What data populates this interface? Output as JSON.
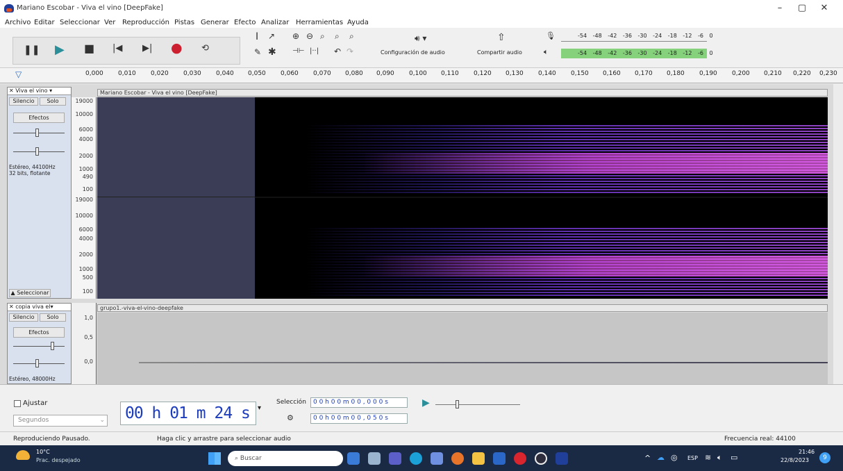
{
  "window": {
    "title": "Mariano Escobar - Viva el vino [DeepFake]",
    "min": "–",
    "max": "▢",
    "close": "✕"
  },
  "menu": [
    "Archivo",
    "Editar",
    "Seleccionar",
    "Ver",
    "Reproducción",
    "Pistas",
    "Generar",
    "Efecto",
    "Analizar",
    "Herramientas",
    "Ayuda"
  ],
  "toolbar": {
    "audio_setup": "Configuración de audio",
    "share_audio": "Compartir audio",
    "meter_ticks": [
      "-54",
      "-48",
      "-42",
      "-36",
      "-30",
      "-24",
      "-18",
      "-12",
      "-6",
      "0"
    ]
  },
  "ruler": [
    "0,000",
    "0,010",
    "0,020",
    "0,030",
    "0,040",
    "0,050",
    "0,060",
    "0,070",
    "0,080",
    "0,090",
    "0,100",
    "0,110",
    "0,120",
    "0,130",
    "0,140",
    "0,150",
    "0,160",
    "0,170",
    "0,180",
    "0,190",
    "0,200",
    "0,210",
    "0,220",
    "0,230"
  ],
  "track1": {
    "name": "Viva el vino",
    "mute": "Silencio",
    "solo": "Solo",
    "effects": "Efectos",
    "info": "Estéreo, 44100Hz\n32 bits, flotante",
    "select": "Seleccionar",
    "clip": "Mariano Escobar - Viva el vino [DeepFake]",
    "scale_top": [
      "19000",
      "10000",
      "6000",
      "4000",
      "2000",
      "1000",
      "490",
      "100"
    ],
    "scale_bottom": [
      "19000",
      "10000",
      "6000",
      "4000",
      "2000",
      "1000",
      "500",
      "100"
    ]
  },
  "track2": {
    "name": "copia viva el",
    "mute": "Silencio",
    "solo": "Solo",
    "effects": "Efectos",
    "info": "Estéreo, 48000Hz",
    "clip": "grupo1.-viva-el-vino-deepfake",
    "scale": [
      "1,0",
      "0,5",
      "0,0"
    ]
  },
  "bottom": {
    "snap": "Ajustar",
    "unit": "Segundos",
    "time": "00 h 01 m 24 s",
    "selection_label": "Selección",
    "sel_start": "0 0 h 0 0 m 0 0 , 0 0 0 s",
    "sel_end": "0 0 h 0 0 m 0 0 , 0 5 0 s"
  },
  "status": {
    "left": "Reproduciendo Pausado.",
    "middle": "Haga clic y arrastre para seleccionar audio",
    "right": "Frecuencia real: 44100"
  },
  "taskbar": {
    "temp": "10°C",
    "weather": "Prac. despejado",
    "search": "Buscar",
    "lang": "ESP",
    "time": "21:46",
    "date": "22/8/2023",
    "badge": "9"
  }
}
